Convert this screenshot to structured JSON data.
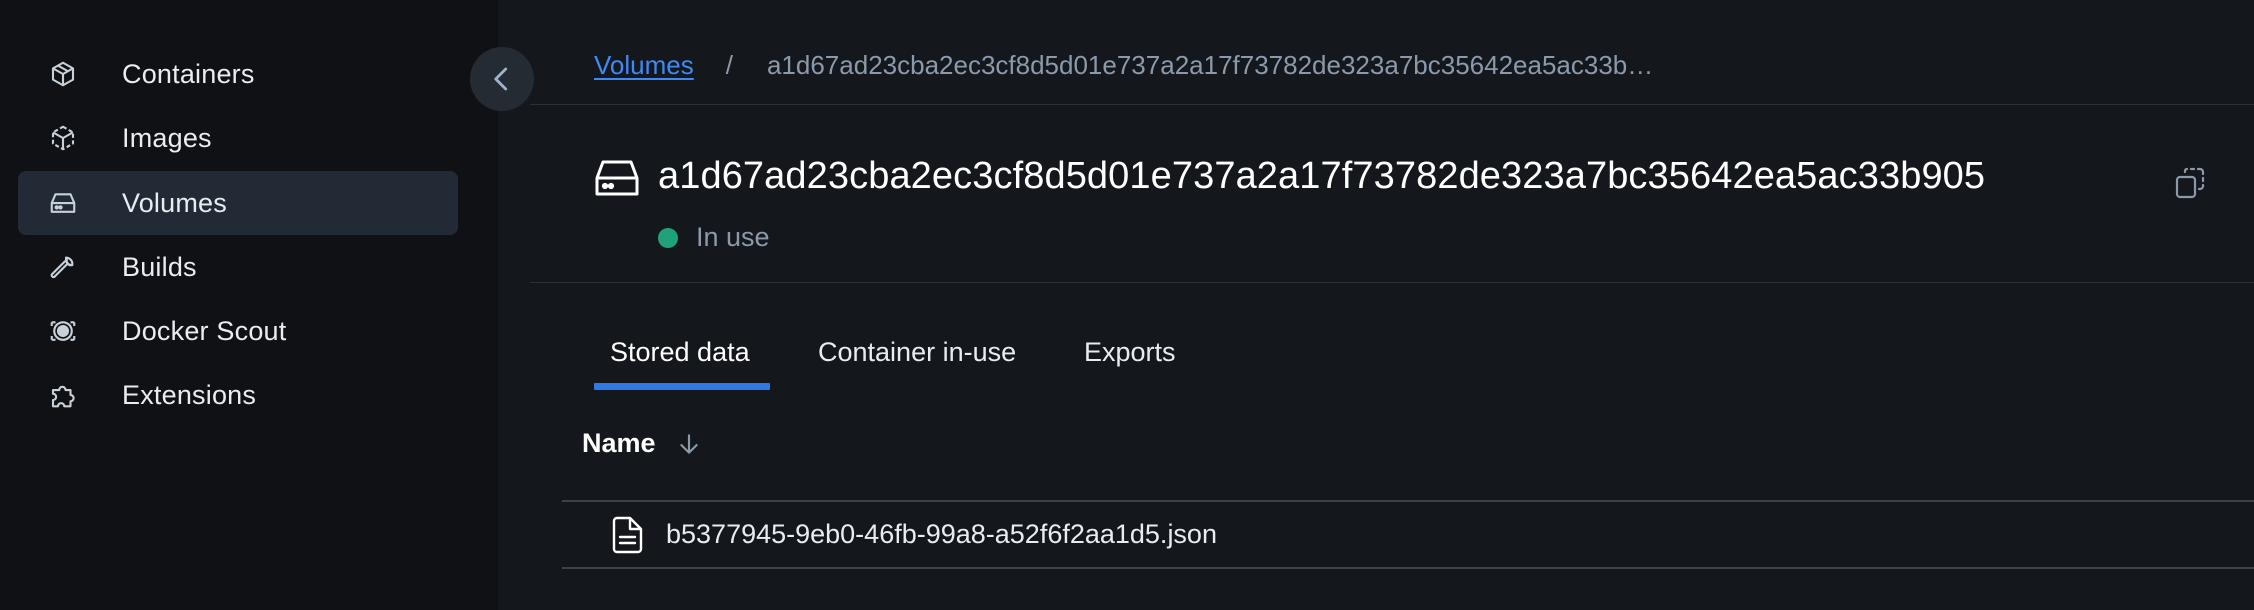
{
  "sidebar": {
    "items": [
      {
        "label": "Containers",
        "icon": "container-icon",
        "active": false
      },
      {
        "label": "Images",
        "icon": "image-icon",
        "active": false
      },
      {
        "label": "Volumes",
        "icon": "volume-icon",
        "active": true
      },
      {
        "label": "Builds",
        "icon": "wrench-icon",
        "active": false
      },
      {
        "label": "Docker Scout",
        "icon": "scout-icon",
        "active": false
      },
      {
        "label": "Extensions",
        "icon": "puzzle-icon",
        "active": false
      }
    ],
    "collapse_icon": "chevron-left-icon"
  },
  "breadcrumb": {
    "root": "Volumes",
    "separator": "/",
    "current": "a1d67ad23cba2ec3cf8d5d01e737a2a17f73782de323a7bc35642ea5ac33b…"
  },
  "header": {
    "title": "a1d67ad23cba2ec3cf8d5d01e737a2a17f73782de323a7bc35642ea5ac33b905",
    "status": "In use",
    "status_color": "#1fa27a",
    "copy_icon": "copy-icon"
  },
  "tabs": [
    {
      "label": "Stored data",
      "active": true
    },
    {
      "label": "Container in-use",
      "active": false
    },
    {
      "label": "Exports",
      "active": false
    }
  ],
  "table": {
    "columns": [
      {
        "label": "Name",
        "sort": "descending"
      }
    ],
    "rows": [
      {
        "name": "b5377945-9eb0-46fb-99a8-a52f6f2aa1d5.json",
        "icon": "file-icon"
      }
    ]
  },
  "colors": {
    "accent": "#2f78e8",
    "link": "#3d8af7",
    "sidebar_bg": "#0f1114",
    "main_bg": "#14171c",
    "active_item_bg": "#222b35"
  }
}
